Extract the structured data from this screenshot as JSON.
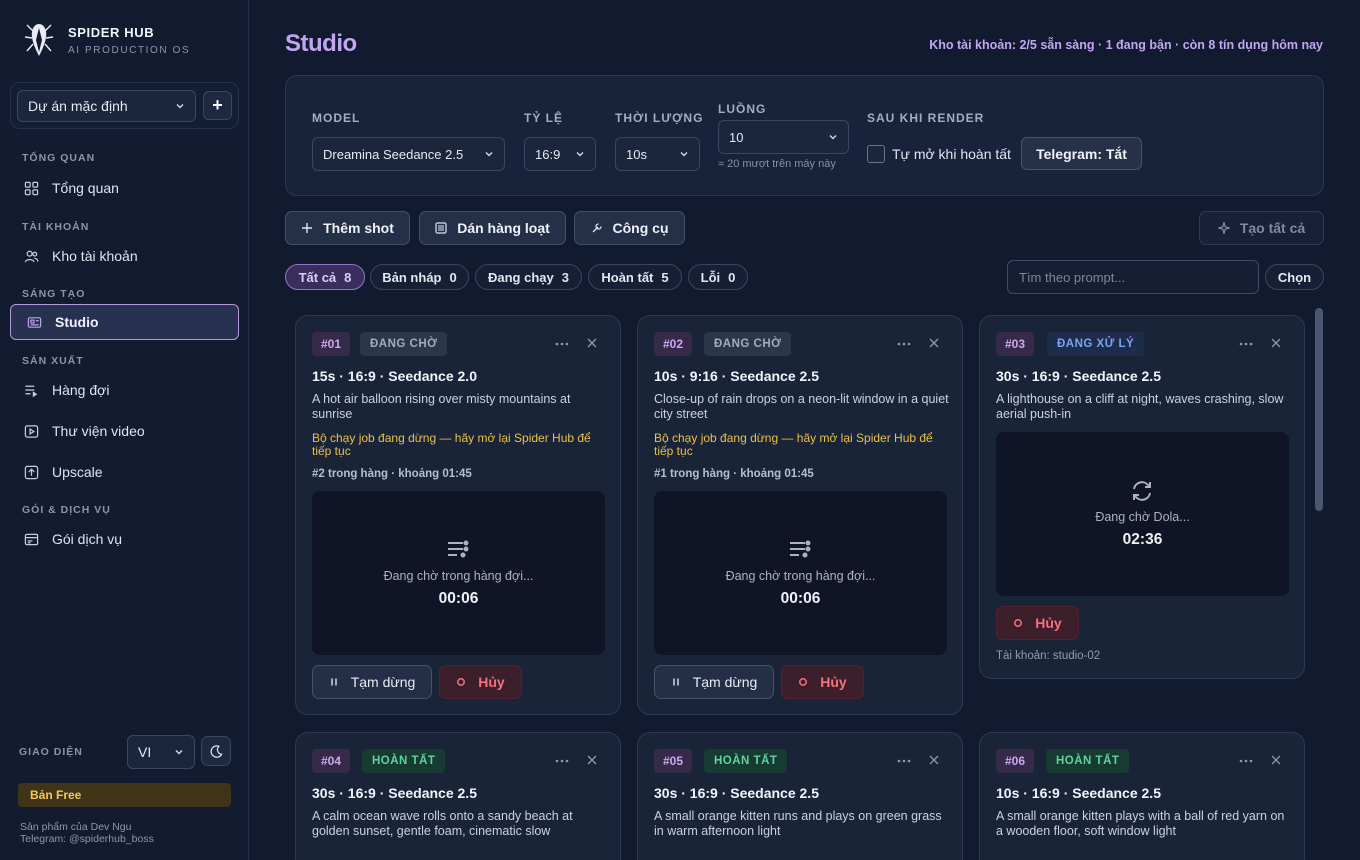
{
  "brand": {
    "title": "SPIDER HUB",
    "subtitle": "AI PRODUCTION OS"
  },
  "project": {
    "selected": "Dự án mặc định",
    "add_label": "+"
  },
  "nav": {
    "sections": [
      {
        "title": "TỔNG QUAN",
        "items": [
          {
            "label": "Tổng quan",
            "icon": "grid-icon"
          }
        ]
      },
      {
        "title": "TÀI KHOẢN",
        "items": [
          {
            "label": "Kho tài khoản",
            "icon": "users-icon"
          }
        ]
      },
      {
        "title": "SÁNG TẠO",
        "items": [
          {
            "label": "Studio",
            "icon": "studio-icon",
            "active": true
          }
        ]
      },
      {
        "title": "SẢN XUẤT",
        "items": [
          {
            "label": "Hàng đợi",
            "icon": "queue-icon"
          },
          {
            "label": "Thư viện video",
            "icon": "play-icon"
          },
          {
            "label": "Upscale",
            "icon": "upscale-icon"
          }
        ]
      },
      {
        "title": "GÓI & DỊCH VỤ",
        "items": [
          {
            "label": "Gói dịch vụ",
            "icon": "plan-icon"
          }
        ]
      }
    ]
  },
  "footer": {
    "theme_label": "GIAO DIỆN",
    "language": "VI",
    "plan": "Bản Free",
    "credit_1": "Sản phẩm của Dev Ngu",
    "credit_2": "Telegram: @spiderhub_boss"
  },
  "header": {
    "title": "Studio",
    "status": "Kho tài khoản: 2/5 sẵn sàng · 1 đang bận · còn 8 tín dụng hôm nay"
  },
  "config": {
    "model_label": "MODEL",
    "model_value": "Dreamina Seedance 2.5",
    "ratio_label": "TỶ LỆ",
    "ratio_value": "16:9",
    "duration_label": "THỜI LƯỢNG",
    "duration_value": "10s",
    "threads_label": "LUỒNG",
    "threads_value": "10",
    "threads_hint": "≈ 20 mượt trên máy này",
    "after_label": "SAU KHI RENDER",
    "auto_open_label": "Tự mở khi hoàn tất",
    "telegram_label": "Telegram: Tắt"
  },
  "actions": {
    "add_shot": "Thêm shot",
    "paste_batch": "Dán hàng loạt",
    "tools": "Công cụ",
    "create_all": "Tạo tất cả"
  },
  "filters": [
    {
      "label": "Tất cả",
      "count": "8",
      "active": true
    },
    {
      "label": "Bản nháp",
      "count": "0"
    },
    {
      "label": "Đang chạy",
      "count": "3"
    },
    {
      "label": "Hoàn tất",
      "count": "5"
    },
    {
      "label": "Lỗi",
      "count": "0"
    }
  ],
  "search": {
    "placeholder": "Tìm theo prompt..."
  },
  "select_label": "Chọn",
  "colors": {
    "accent": "#c3a6f2",
    "warning": "#eac045",
    "danger": "#f4727f",
    "success": "#5fd3a0",
    "info": "#79a4f4"
  },
  "cards": [
    {
      "id": "#01",
      "status": "ĐANG CHỜ",
      "head": "15s · 16:9 · Seedance 2.0",
      "prompt": "A hot air balloon rising over misty mountains at sunrise",
      "warning": "Bộ chạy job đang dừng — hãy mở lại Spider Hub để tiếp tục",
      "queue": "#2 trong hàng · khoảng 01:45",
      "preview_text": "Đang chờ trong hàng đợi...",
      "preview_time": "00:06",
      "pause_label": "Tạm dừng",
      "cancel_label": "Hủy"
    },
    {
      "id": "#02",
      "status": "ĐANG CHỜ",
      "head": "10s · 9:16 · Seedance 2.5",
      "prompt": "Close-up of rain drops on a neon-lit window in a quiet city street",
      "warning": "Bộ chạy job đang dừng — hãy mở lại Spider Hub để tiếp tục",
      "queue": "#1 trong hàng · khoảng 01:45",
      "preview_text": "Đang chờ trong hàng đợi...",
      "preview_time": "00:06",
      "pause_label": "Tạm dừng",
      "cancel_label": "Hủy"
    },
    {
      "id": "#03",
      "status": "ĐANG XỬ LÝ",
      "head": "30s · 16:9 · Seedance 2.5",
      "prompt": "A lighthouse on a cliff at night, waves crashing, slow aerial push-in",
      "preview_text": "Đang chờ Dola...",
      "preview_time": "02:36",
      "cancel_label": "Hủy",
      "account": "Tài khoản: studio-02"
    },
    {
      "id": "#04",
      "status": "HOÀN TẤT",
      "head": "30s · 16:9 · Seedance 2.5",
      "prompt": "A calm ocean wave rolls onto a sandy beach at golden sunset, gentle foam, cinematic slow"
    },
    {
      "id": "#05",
      "status": "HOÀN TẤT",
      "head": "30s · 16:9 · Seedance 2.5",
      "prompt": "A small orange kitten runs and plays on green grass in warm afternoon light"
    },
    {
      "id": "#06",
      "status": "HOÀN TẤT",
      "head": "10s · 16:9 · Seedance 2.5",
      "prompt": "A small orange kitten plays with a ball of red yarn on a wooden floor, soft window light"
    }
  ]
}
